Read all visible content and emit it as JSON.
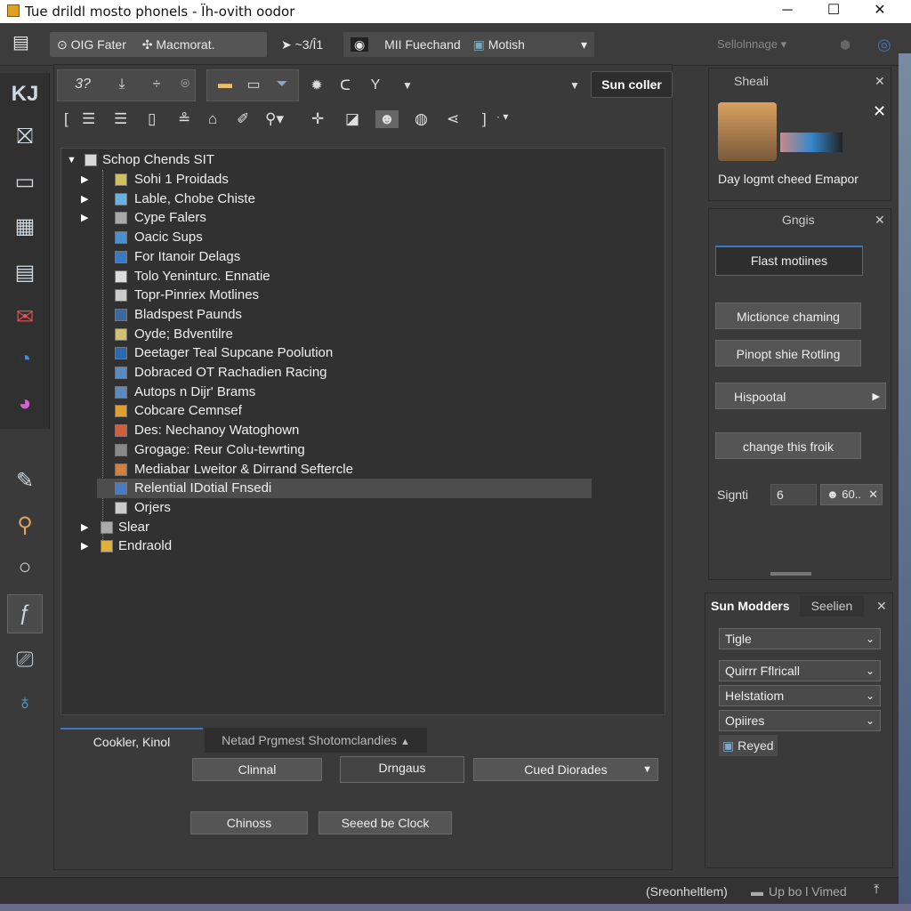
{
  "window": {
    "title": "Tue drildl mosto phonels - Ïh-ovith oodor",
    "minimize": "─",
    "maximize": "☐",
    "close": "✕"
  },
  "toolbar1": {
    "item1": "OIG Fater",
    "item2": "Macmorat.",
    "item3": "~3/Î1",
    "item4": "MII Fuechand",
    "item5": "Motish",
    "item6": "Sellolnnage"
  },
  "toolbar2": {
    "counter": "3?",
    "sun_coller": "Sun coller"
  },
  "tree": {
    "root": "Schop Chends SIT",
    "items": [
      "Sohi 1 Proidads",
      "Lable,  Chobe Chiste",
      "Cype Falers",
      "Oacic Sups",
      "For Itanoir Delags",
      "Tolo Yeninturc. Ennatie",
      "Topr-Pinriex Motlines",
      "Bladspest Paunds",
      "Oyde; Bdventilre",
      "Deetager Teal Supcane Poolution",
      "Dobraced OT Rachadien Racing",
      "Autops n Dijr' Brams",
      "Cobcare Cemnsef",
      "Des: Nechanoy Watoghown",
      "Grogage: Reur Colu-tewrting",
      "Mediabar Lweitor & Dirrand Seftercle",
      "Relential  IDotial Fnsedi",
      "Orjers",
      "Slear",
      "Endraold"
    ]
  },
  "bottom_tabs": {
    "tab1": "Cookler, Kinol",
    "tab2": "Netad Prgmest Shotomclandies"
  },
  "bottom_buttons": {
    "b1": "Clinnal",
    "b2": "Drngaus",
    "b3": "Cued Diorades",
    "b4": "Chinoss",
    "b5": "Seeed be Clock"
  },
  "panel_preview": {
    "title": "Sheali",
    "caption": "Day logmt cheed Emapor"
  },
  "panel_actions": {
    "title": "Gngis",
    "b1": "Flast motiines",
    "b2": "Mictionce chaming",
    "b3": "Pinopt shie Rotling",
    "b4": "Hispootal",
    "b5": "change this froik",
    "signti_label": "Signti",
    "signti_value": "6",
    "signti_tag": "60.."
  },
  "panel_modders": {
    "tab1": "Sun Modders",
    "tab2": "Seelien",
    "selects": [
      "Tigle",
      "Quirrr Fflricall",
      "Helstatiom",
      "Opiires"
    ],
    "chip": "Reyed"
  },
  "status": {
    "left": "(Sreonheltlem)",
    "right": "Up bo l Vimed"
  },
  "colors": {
    "accent": "#3a78c8",
    "panel_bg": "#3a3a3a",
    "selected_row": "#4d4d4d"
  }
}
